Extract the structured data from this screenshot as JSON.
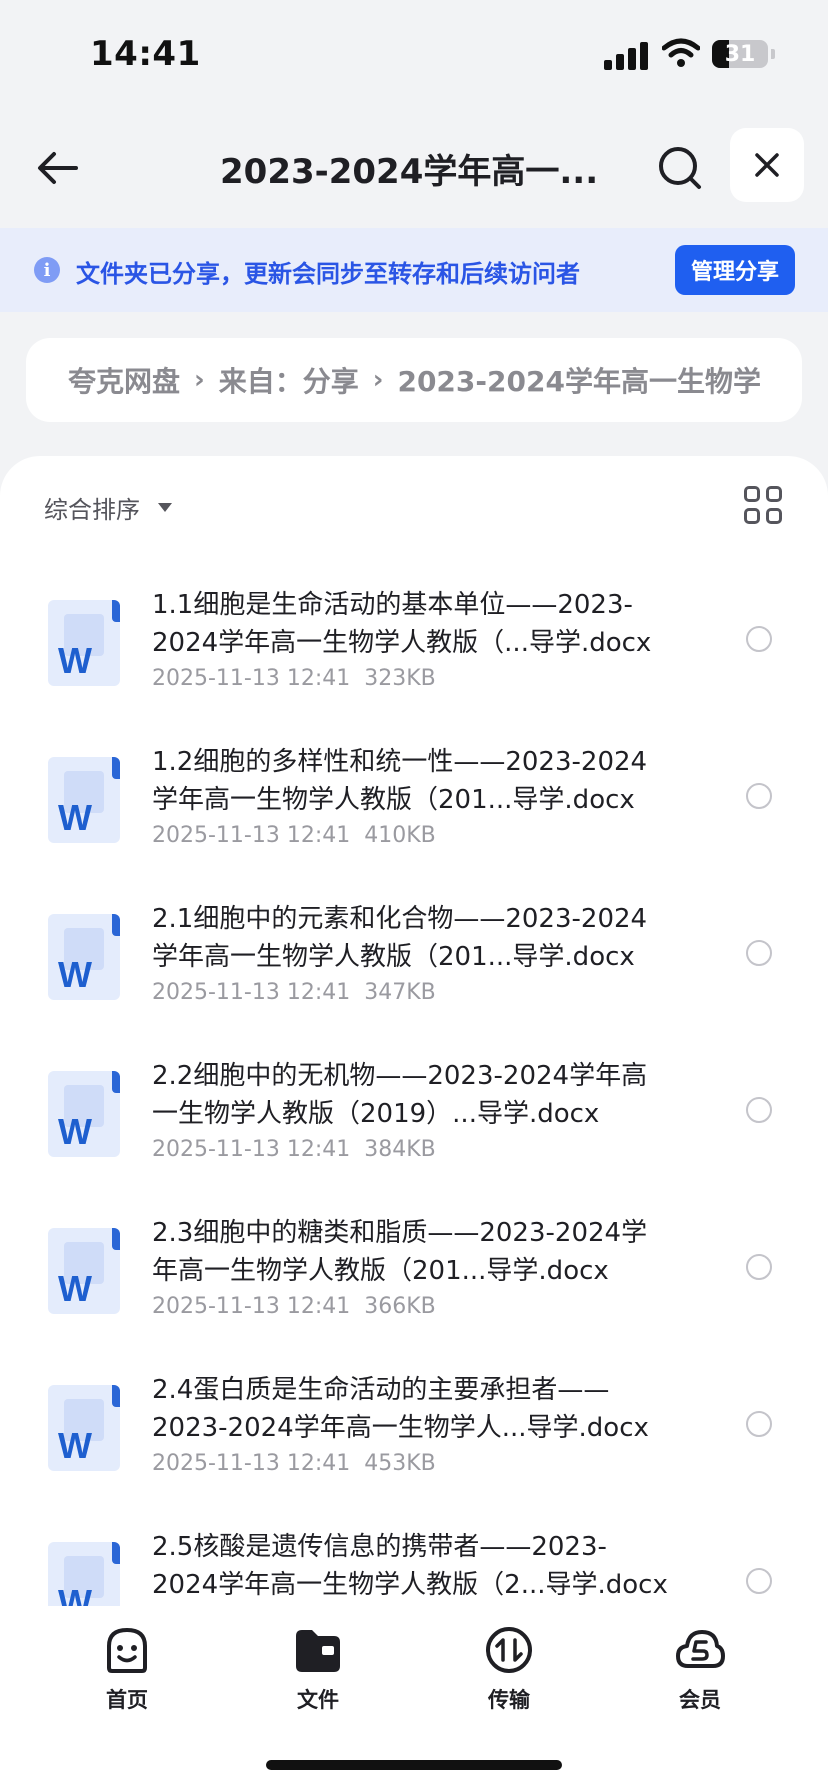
{
  "status_bar": {
    "time": "14:41",
    "battery": "31",
    "battery_level": 0.31,
    "icons": [
      "signal-icon",
      "wifi-icon",
      "battery-icon"
    ]
  },
  "nav": {
    "title": "2023-2024学年高一...",
    "icons": [
      "arrow-left-icon",
      "search-icon",
      "close-icon"
    ]
  },
  "banner": {
    "text": "文件夹已分享，更新会同步至转存和后续访问者",
    "button": "管理分享",
    "icon": "info-icon"
  },
  "breadcrumb": {
    "items": [
      "夸克网盘",
      "来自：分享",
      "2023-2024学年高一生物学"
    ],
    "separator": "›"
  },
  "toolbar": {
    "sort_label": "综合排序",
    "icons": [
      "caret-down-icon",
      "grid-view-icon"
    ]
  },
  "files": [
    {
      "name": "1.1细胞是生命活动的基本单位——2023-2024学年高一生物学人教版（...导学.docx",
      "date": "2025-11-13 12:41",
      "size": "323KB"
    },
    {
      "name": "1.2细胞的多样性和统一性——2023-2024学年高一生物学人教版（201...导学.docx",
      "date": "2025-11-13 12:41",
      "size": "410KB"
    },
    {
      "name": "2.1细胞中的元素和化合物——2023-2024学年高一生物学人教版（201...导学.docx",
      "date": "2025-11-13 12:41",
      "size": "347KB"
    },
    {
      "name": "2.2细胞中的无机物——2023-2024学年高一生物学人教版（2019）...导学.docx",
      "date": "2025-11-13 12:41",
      "size": "384KB"
    },
    {
      "name": "2.3细胞中的糖类和脂质——2023-2024学年高一生物学人教版（201...导学.docx",
      "date": "2025-11-13 12:41",
      "size": "366KB"
    },
    {
      "name": "2.4蛋白质是生命活动的主要承担者——2023-2024学年高一生物学人...导学.docx",
      "date": "2025-11-13 12:41",
      "size": "453KB"
    },
    {
      "name": "2.5核酸是遗传信息的携带者——2023-2024学年高一生物学人教版（2...导学.docx",
      "date": "",
      "size": ""
    }
  ],
  "file_icon_letter": "W",
  "tabbar": {
    "tabs": [
      {
        "label": "首页",
        "icon": "home-face-icon"
      },
      {
        "label": "文件",
        "icon": "folder-icon"
      },
      {
        "label": "传输",
        "icon": "transfer-icon"
      },
      {
        "label": "会员",
        "icon": "vip-cloud-icon"
      }
    ]
  },
  "colors": {
    "accent": "#1f5ff0",
    "banner_bg": "#e8edfb",
    "banner_text": "#2a55e5",
    "word_blue": "#1e5fcf"
  }
}
